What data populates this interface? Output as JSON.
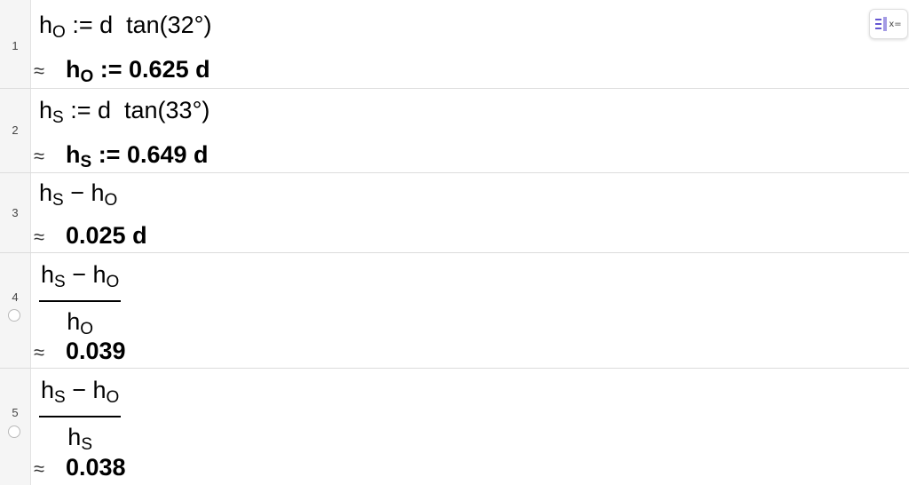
{
  "rows": [
    {
      "num": "1",
      "input": {
        "a": "h",
        "as": "O",
        "rest": " := d  tan(32°)"
      },
      "output": {
        "approx": "≈",
        "a": "h",
        "as": "O",
        "rest": " := 0.625 d"
      }
    },
    {
      "num": "2",
      "input": {
        "a": "h",
        "as": "S",
        "rest": " := d  tan(33°)"
      },
      "output": {
        "approx": "≈",
        "a": "h",
        "as": "S",
        "rest": " := 0.649 d"
      }
    },
    {
      "num": "3",
      "input": {
        "a": "h",
        "as": "S",
        "mid": " − h",
        "bs": "O"
      },
      "output": {
        "approx": "≈",
        "value": "0.025 d"
      }
    },
    {
      "num": "4",
      "num_expr": {
        "a": "h",
        "as": "S",
        "mid": " − h",
        "bs": "O"
      },
      "den_expr": {
        "a": "h",
        "as": "O"
      },
      "output": {
        "approx": "≈",
        "value": "0.039"
      }
    },
    {
      "num": "5",
      "num_expr": {
        "a": "h",
        "as": "S",
        "mid": " − h",
        "bs": "O"
      },
      "den_expr": {
        "a": "h",
        "as": "S"
      },
      "output": {
        "approx": "≈",
        "value": "0.038"
      }
    }
  ],
  "toolbar": {
    "toggle_icon": "algebra-view-toggle-icon",
    "toggle_text": "x="
  }
}
